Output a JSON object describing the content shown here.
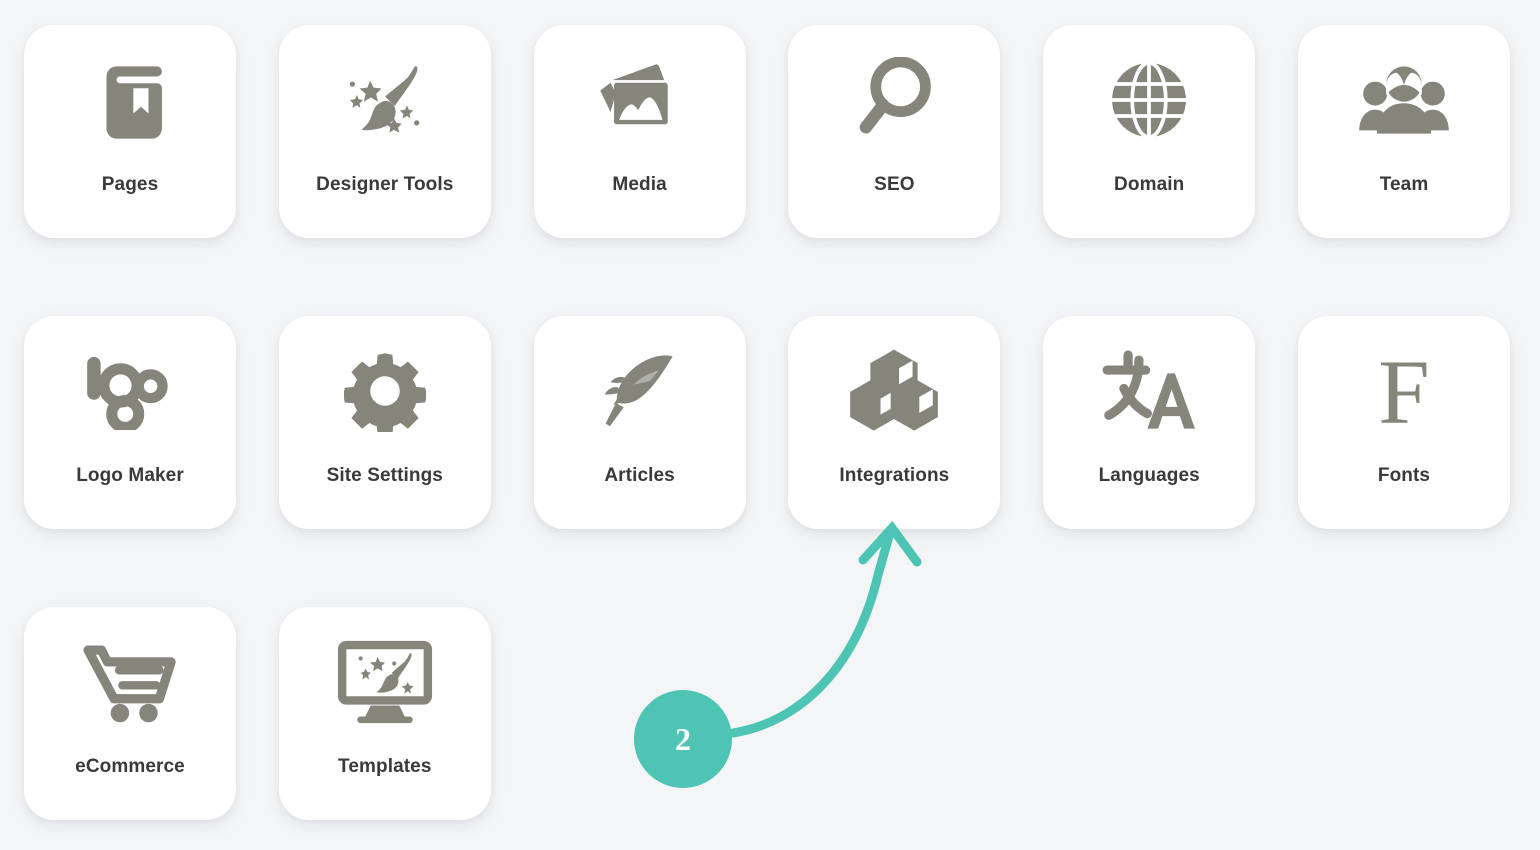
{
  "page": {
    "background_color": "#f4f5f7",
    "card_color": "#ffffff",
    "icon_color": "#85857c",
    "label_color": "#3a3a3a",
    "accent_color": "#4dc4b4"
  },
  "grid": {
    "columns": 6,
    "items": [
      {
        "label": "Pages",
        "icon": "book-icon",
        "row": 0,
        "col": 0
      },
      {
        "label": "Designer Tools",
        "icon": "paintbrush-stars-icon",
        "row": 0,
        "col": 1
      },
      {
        "label": "Media",
        "icon": "photos-stack-icon",
        "row": 0,
        "col": 2
      },
      {
        "label": "SEO",
        "icon": "magnifier-icon",
        "row": 0,
        "col": 3
      },
      {
        "label": "Domain",
        "icon": "globe-icon",
        "row": 0,
        "col": 4
      },
      {
        "label": "Team",
        "icon": "people-group-icon",
        "row": 0,
        "col": 5
      },
      {
        "label": "Logo Maker",
        "icon": "logo-wordmark-icon",
        "row": 1,
        "col": 0
      },
      {
        "label": "Site Settings",
        "icon": "gear-icon",
        "row": 1,
        "col": 1
      },
      {
        "label": "Articles",
        "icon": "feather-quill-icon",
        "row": 1,
        "col": 2
      },
      {
        "label": "Integrations",
        "icon": "cubes-icon",
        "row": 1,
        "col": 3
      },
      {
        "label": "Languages",
        "icon": "translate-icon",
        "row": 1,
        "col": 4
      },
      {
        "label": "Fonts",
        "icon": "letter-f-serif-icon",
        "row": 1,
        "col": 5
      },
      {
        "label": "eCommerce",
        "icon": "shopping-cart-icon",
        "row": 2,
        "col": 0
      },
      {
        "label": "Templates",
        "icon": "monitor-brush-icon",
        "row": 2,
        "col": 1
      }
    ]
  },
  "annotation": {
    "step_number": "2",
    "color": "#4dc4b4",
    "target_label": "Integrations"
  }
}
